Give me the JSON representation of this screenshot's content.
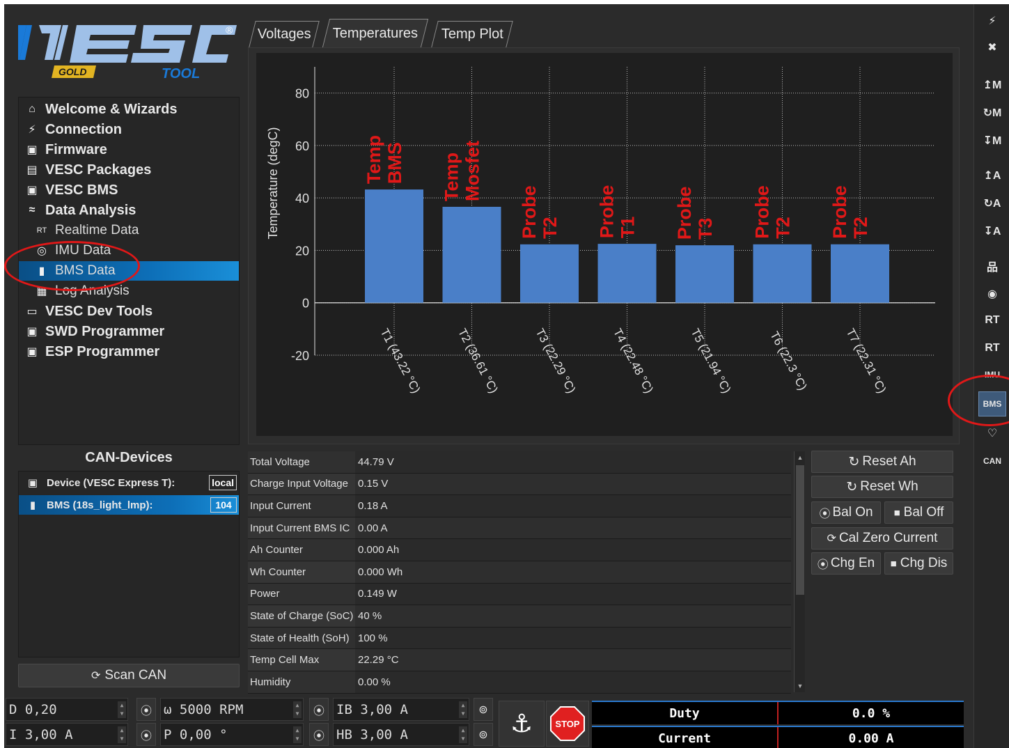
{
  "logo": {
    "brand": "VESC",
    "edition": "GOLD",
    "product": "TOOL",
    "reg": "®"
  },
  "nav": {
    "items": [
      {
        "label": "Welcome & Wizards",
        "icon": "home-icon",
        "glyph": "⌂"
      },
      {
        "label": "Connection",
        "icon": "plug-icon",
        "glyph": "⚡"
      },
      {
        "label": "Firmware",
        "icon": "chip-icon",
        "glyph": "▣"
      },
      {
        "label": "VESC Packages",
        "icon": "package-icon",
        "glyph": "▤"
      },
      {
        "label": "VESC BMS",
        "icon": "chip-icon",
        "glyph": "▣"
      },
      {
        "label": "Data Analysis",
        "icon": "analysis-icon",
        "glyph": "≈"
      }
    ],
    "sub_items": [
      {
        "label": "Realtime Data",
        "icon": "realtime-icon",
        "glyph": "RT"
      },
      {
        "label": "IMU Data",
        "icon": "imu-icon",
        "glyph": "◎"
      },
      {
        "label": "BMS Data",
        "icon": "battery-icon",
        "glyph": "▮"
      },
      {
        "label": "Log Analysis",
        "icon": "log-icon",
        "glyph": "▦"
      }
    ],
    "items2": [
      {
        "label": "VESC Dev Tools",
        "icon": "terminal-icon",
        "glyph": "▭"
      },
      {
        "label": "SWD Programmer",
        "icon": "chip-icon",
        "glyph": "▣"
      },
      {
        "label": "ESP Programmer",
        "icon": "chip-icon",
        "glyph": "▣"
      }
    ]
  },
  "can": {
    "title": "CAN-Devices",
    "devices": [
      {
        "label": "Device (VESC Express T):",
        "badge": "local",
        "glyph": "▣"
      },
      {
        "label": "BMS (18s_light_lmp):",
        "badge": "104",
        "glyph": "▮"
      }
    ],
    "scan_label": "Scan CAN",
    "scan_glyph": "⟳"
  },
  "tabs": [
    {
      "label": "Voltages"
    },
    {
      "label": "Temperatures"
    },
    {
      "label": "Temp Plot"
    }
  ],
  "chart_data": {
    "type": "bar",
    "categories": [
      "T1 (43.22 °C)",
      "T2 (36.61 °C)",
      "T3 (22.29 °C)",
      "T4 (22.48 °C)",
      "T5 (21.94 °C)",
      "T6 (22.3 °C)",
      "T7 (22.31 °C)"
    ],
    "values": [
      43.22,
      36.61,
      22.29,
      22.48,
      21.94,
      22.3,
      22.31
    ],
    "annotations": [
      [
        "Temp",
        "BMS"
      ],
      [
        "Temp",
        "Mosfet"
      ],
      [
        "Probe",
        "T2"
      ],
      [
        "Probe",
        "T1"
      ],
      [
        "Probe",
        "T3"
      ],
      [
        "Probe",
        "T2"
      ],
      [
        "Probe",
        "T2"
      ]
    ],
    "ylabel": "Temperature (degC)",
    "xlabel": "",
    "title": "",
    "ylim": [
      -20,
      90
    ],
    "yticks": [
      -20,
      0,
      20,
      40,
      60,
      80
    ],
    "grid": true,
    "bar_color": "#4a7fc8",
    "annotation_color": "#e01818"
  },
  "table": {
    "rows": [
      {
        "key": "Total Voltage",
        "value": "44.79 V"
      },
      {
        "key": "Charge Input Voltage",
        "value": "0.15 V"
      },
      {
        "key": "Input Current",
        "value": "0.18 A"
      },
      {
        "key": "Input Current BMS IC",
        "value": "0.00 A"
      },
      {
        "key": "Ah Counter",
        "value": "0.000 Ah"
      },
      {
        "key": "Wh Counter",
        "value": "0.000 Wh"
      },
      {
        "key": "Power",
        "value": "0.149 W"
      },
      {
        "key": "State of Charge (SoC)",
        "value": "40 %"
      },
      {
        "key": "State of Health (SoH)",
        "value": "100 %"
      },
      {
        "key": "Temp Cell Max",
        "value": "22.29 °C"
      },
      {
        "key": "Humidity",
        "value": "0.00 %"
      }
    ]
  },
  "buttons": {
    "reset_ah": "Reset Ah",
    "reset_wh": "Reset Wh",
    "bal_on": "Bal On",
    "bal_off": "Bal Off",
    "cal_zero": "Cal Zero Current",
    "chg_en": "Chg En",
    "chg_dis": "Chg Dis",
    "reset_glyph": "↻",
    "play_glyph": "⦿",
    "stop_glyph": "■",
    "cal_glyph": "⟳"
  },
  "right_bar": [
    {
      "icon": "connect-icon",
      "glyph": "⚡"
    },
    {
      "icon": "disconnect-icon",
      "glyph": "✖"
    },
    {
      "icon": "read-motor-config-icon",
      "glyph": "↥M"
    },
    {
      "icon": "read-default-motor-config-icon",
      "glyph": "↻M"
    },
    {
      "icon": "write-motor-config-icon",
      "glyph": "↧M"
    },
    {
      "icon": "read-app-config-icon",
      "glyph": "↥A"
    },
    {
      "icon": "read-default-app-config-icon",
      "glyph": "↻A"
    },
    {
      "icon": "write-app-config-icon",
      "glyph": "↧A"
    },
    {
      "icon": "can-network-icon",
      "glyph": "品"
    },
    {
      "icon": "gamepad-icon",
      "glyph": "◉"
    },
    {
      "icon": "realtime-icon",
      "glyph": "RT"
    },
    {
      "icon": "realtime-app-icon",
      "glyph": "RT"
    },
    {
      "icon": "imu-icon",
      "glyph": "IMU"
    },
    {
      "icon": "bms-icon",
      "glyph": "BMS"
    },
    {
      "icon": "heart-icon",
      "glyph": "♡"
    },
    {
      "icon": "can-icon",
      "glyph": "CAN"
    }
  ],
  "bottom": {
    "duty_input": "D 0,20",
    "rpm_input": "ω 5000 RPM",
    "ib_input": "IB 3,00 A",
    "current_input": "I 3,00 A",
    "pos_input": "P 0,00 °",
    "hb_input": "HB 3,00 A",
    "play_glyph": "⦿",
    "brake_glyph": "⊚",
    "anchor_glyph": "⚓",
    "stop_label": "STOP",
    "gauges": [
      {
        "label": "Duty",
        "value": "0.0 %"
      },
      {
        "label": "Current",
        "value": "0.00 A"
      }
    ]
  }
}
